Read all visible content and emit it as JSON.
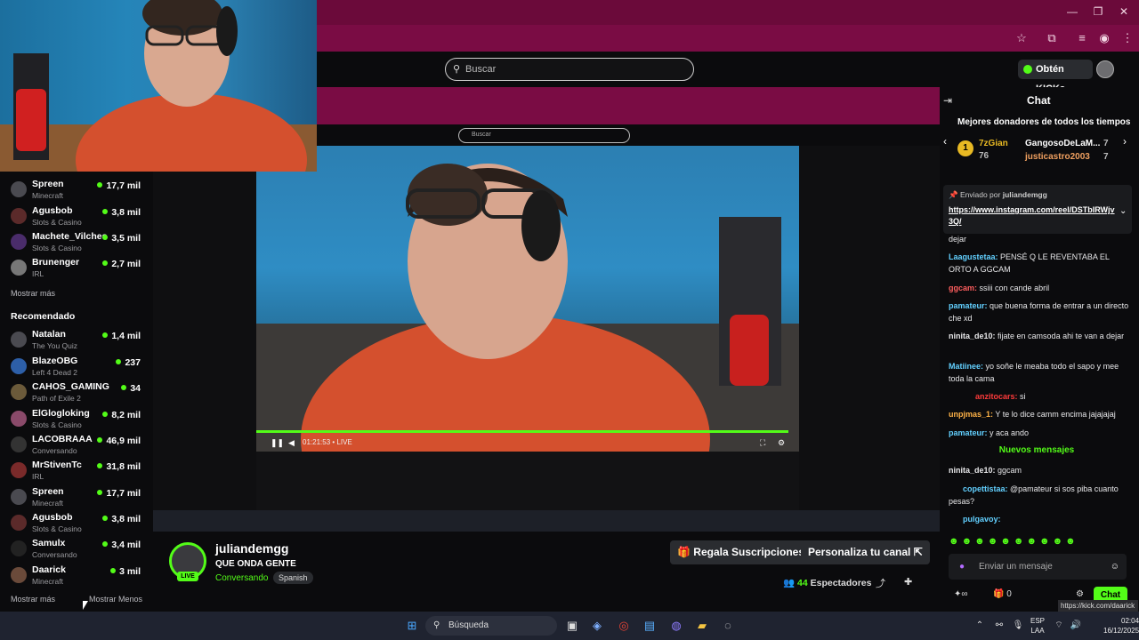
{
  "search": {
    "placeholder": "Buscar"
  },
  "header": {
    "kicks_label": "Obtén KICKs"
  },
  "sidebar": {
    "following": [
      {
        "name": "Spreen",
        "category": "Minecraft",
        "viewers": "17,7 mil"
      },
      {
        "name": "Agusbob",
        "category": "Slots & Casino",
        "viewers": "3,8 mil"
      },
      {
        "name": "Machete_Vilches",
        "category": "Slots & Casino",
        "viewers": "3,5 mil"
      },
      {
        "name": "Brunenger",
        "category": "IRL",
        "viewers": "2,7 mil"
      }
    ],
    "show_more_1": "Mostrar más",
    "recommended_title": "Recomendado",
    "recommended": [
      {
        "name": "Natalan",
        "category": "The You Quiz",
        "viewers": "1,4 mil"
      },
      {
        "name": "BlazeOBG",
        "category": "Left 4 Dead 2",
        "viewers": "237"
      },
      {
        "name": "CAHOS_GAMING",
        "category": "Path of Exile 2",
        "viewers": "34"
      },
      {
        "name": "ElGlogloking",
        "category": "Slots & Casino",
        "viewers": "8,2 mil"
      },
      {
        "name": "LACOBRAAA",
        "category": "Conversando",
        "viewers": "46,9 mil"
      },
      {
        "name": "MrStivenTc",
        "category": "IRL",
        "viewers": "31,8 mil"
      },
      {
        "name": "Spreen",
        "category": "Minecraft",
        "viewers": "17,7 mil"
      },
      {
        "name": "Agusbob",
        "category": "Slots & Casino",
        "viewers": "3,8 mil"
      },
      {
        "name": "Samulx",
        "category": "Conversando",
        "viewers": "3,4 mil"
      },
      {
        "name": "Daarick",
        "category": "Minecraft",
        "viewers": "3 mil"
      }
    ],
    "show_more_2": "Mostrar más",
    "show_less": "Mostrar Menos"
  },
  "video": {
    "time": "01:21:53",
    "live_label": "• LIVE",
    "progress": 0.98
  },
  "stream": {
    "streamer": "juliandemgg",
    "title": "QUE ONDA GENTE",
    "category": "Conversando",
    "language": "Spanish",
    "live_badge": "LIVE",
    "subs_button": "Regala Suscripciones",
    "customize_button": "Personaliza tu canal",
    "viewers_count": "44",
    "viewers_label": "Espectadores"
  },
  "chat": {
    "title": "Chat",
    "donors_title": "Mejores donadores de todos los tiempos",
    "donors": [
      {
        "rank": "1",
        "name": "7zGian",
        "amount": "76"
      },
      {
        "name": "GangosoDeLaM...",
        "amount": "7"
      },
      {
        "name": "justicastro2003",
        "amount": "7"
      }
    ],
    "pinned_by_label": "Enviado por",
    "pinned_by": "juliandemgg",
    "pinned_link": "https://www.instagram.com/reel/DSTbIRWjv3Q/",
    "messages_before": [
      {
        "user": "",
        "text": "dejar"
      },
      {
        "user": "Laagustetaa:",
        "text": "PENSÉ Q LE REVENTABA EL ORTO A GGCAM"
      },
      {
        "user": "ggcam:",
        "text": "ssiii con cande abril"
      },
      {
        "user": "pamateur:",
        "text": "que buena forma de entrar a un directo che xd"
      },
      {
        "user": "ninita_de10:",
        "text": "fijate en camsoda ahi te van a dejar"
      },
      {
        "user": "Matiinee:",
        "text": "yo soñe le meaba todo el sapo y mee toda la cama"
      },
      {
        "user": "anzitocars:",
        "text": "si"
      },
      {
        "user": "unpjmas_1:",
        "text": "Y te lo dice camm encima jajajajaj"
      },
      {
        "user": "pamateur:",
        "text": "y aca ando"
      }
    ],
    "new_messages_label": "Nuevos mensajes",
    "messages_after": [
      {
        "user": "ninita_de10:",
        "text": "ggcam"
      },
      {
        "user": "copettistaa:",
        "text": "@pamateur si sos piba cuanto pesas?"
      },
      {
        "user": "pulgavoy:",
        "text": ""
      }
    ],
    "input_placeholder": "Enviar un mensaje",
    "kick_count": "0",
    "send_button": "Chat",
    "url_tooltip": "https://kick.com/daarick"
  },
  "taskbar": {
    "search_label": "Búsqueda",
    "lang_line1": "ESP",
    "lang_line2": "LAA",
    "time": "02:04",
    "date": "16/12/2025"
  },
  "colors": {
    "accent": "#53fc18",
    "browser_chrome": "#7a0c44",
    "background": "#0b0b0d"
  }
}
